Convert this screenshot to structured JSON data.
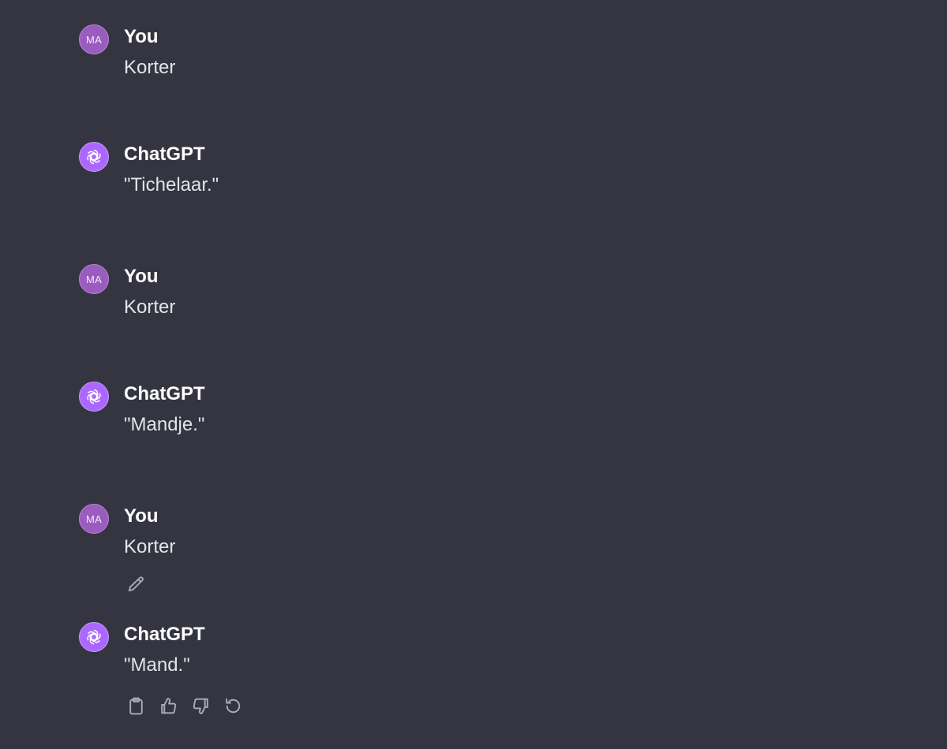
{
  "conversation": {
    "messages": [
      {
        "role": "user",
        "author": "You",
        "avatar_initials": "MA",
        "text": "Korter"
      },
      {
        "role": "assistant",
        "author": "ChatGPT",
        "avatar_icon": "openai-logo-icon",
        "text": "\"Tichelaar.\""
      },
      {
        "role": "user",
        "author": "You",
        "avatar_initials": "MA",
        "text": "Korter"
      },
      {
        "role": "assistant",
        "author": "ChatGPT",
        "avatar_icon": "openai-logo-icon",
        "text": "\"Mandje.\""
      },
      {
        "role": "user",
        "author": "You",
        "avatar_initials": "MA",
        "text": "Korter",
        "actions": [
          "edit-icon"
        ]
      },
      {
        "role": "assistant",
        "author": "ChatGPT",
        "avatar_icon": "openai-logo-icon",
        "text": "\"Mand.\"",
        "actions": [
          "copy-icon",
          "thumbs-up-icon",
          "thumbs-down-icon",
          "regenerate-icon"
        ]
      }
    ]
  },
  "colors": {
    "background": "#343541",
    "user_avatar": "#9b5cbf",
    "assistant_avatar": "#ab68ff",
    "icon_gray": "#acacbe"
  }
}
